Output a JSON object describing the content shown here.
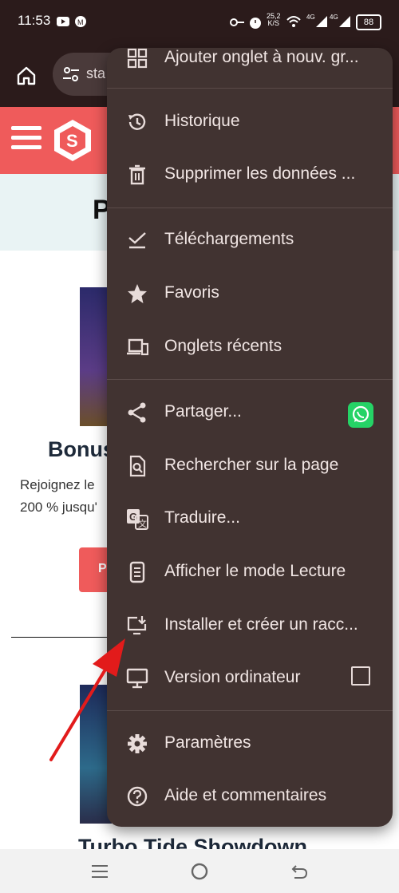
{
  "status_bar": {
    "time": "11:53",
    "speed_value": "25,2",
    "speed_unit": "K/S",
    "network_1": "4G",
    "network_2": "4G",
    "battery": "88"
  },
  "toolbar": {
    "url_prefix": "sta"
  },
  "website": {
    "header_letter": "S",
    "hero_initial": "P",
    "bonus_title": "Bonus",
    "bonus_desc_line1": "Rejoignez le",
    "bonus_desc_line2": "200 % jusqu'",
    "cta_initial": "P",
    "game_title": "Turbo Tide Showdown"
  },
  "menu": {
    "items": [
      {
        "label": "Ajouter onglet à nouv. gr...",
        "icon": "add-to-group-icon"
      },
      {
        "label": "Historique",
        "icon": "history-icon"
      },
      {
        "label": "Supprimer les données ...",
        "icon": "trash-icon"
      },
      {
        "label": "Téléchargements",
        "icon": "download-check-icon"
      },
      {
        "label": "Favoris",
        "icon": "star-icon"
      },
      {
        "label": "Onglets récents",
        "icon": "devices-icon"
      },
      {
        "label": "Partager...",
        "icon": "share-icon"
      },
      {
        "label": "Rechercher sur la page",
        "icon": "find-in-page-icon"
      },
      {
        "label": "Traduire...",
        "icon": "translate-icon"
      },
      {
        "label": "Afficher le mode Lecture",
        "icon": "reader-mode-icon"
      },
      {
        "label": "Installer et créer un racc...",
        "icon": "install-app-icon"
      },
      {
        "label": "Version ordinateur",
        "icon": "desktop-icon"
      },
      {
        "label": "Paramètres",
        "icon": "settings-icon"
      },
      {
        "label": "Aide et commentaires",
        "icon": "help-icon"
      }
    ]
  },
  "colors": {
    "menu_bg": "#413331",
    "menu_text": "#f1e6e4",
    "site_red": "#ef5b5b",
    "annotation_arrow": "#e21b1b"
  }
}
